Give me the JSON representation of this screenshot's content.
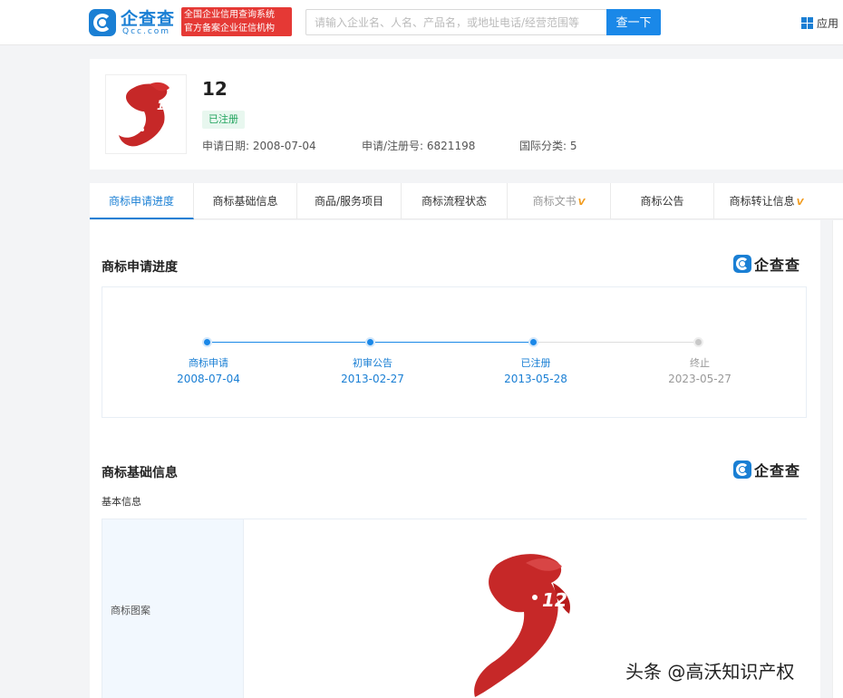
{
  "header": {
    "logo_cn": "企查查",
    "logo_en": "Qcc.com",
    "badge_line1": "全国企业信用查询系统",
    "badge_line2": "官方备案企业征信机构",
    "search_placeholder": "请输入企业名、人名、产品名，或地址电话/经营范围等",
    "search_button": "查一下",
    "apps_label": "应用",
    "brand_color": "#1a7fd4"
  },
  "trademark": {
    "name": "12",
    "status": "已注册",
    "apply_date": "申请日期: 2008-07-04",
    "reg_no": "申请/注册号: 6821198",
    "intl_class": "国际分类: 5"
  },
  "tabs": [
    {
      "label": "商标申请进度",
      "active": true
    },
    {
      "label": "商标基础信息"
    },
    {
      "label": "商品/服务项目"
    },
    {
      "label": "商标流程状态"
    },
    {
      "label": "商标文书",
      "vip": true
    },
    {
      "label": "商标公告"
    },
    {
      "label": "商标转让信息",
      "vip": true
    }
  ],
  "vip_mark": "V",
  "progress": {
    "title": "商标申请进度",
    "brand": "企查查",
    "steps": [
      {
        "label": "商标申请",
        "date": "2008-07-04",
        "done": true
      },
      {
        "label": "初审公告",
        "date": "2013-02-27",
        "done": true
      },
      {
        "label": "已注册",
        "date": "2013-05-28",
        "done": true
      },
      {
        "label": "终止",
        "date": "2023-05-27",
        "done": false
      }
    ]
  },
  "basic_info": {
    "title": "商标基础信息",
    "brand": "企查查",
    "sub_title": "基本信息",
    "row_label": "商标图案"
  },
  "watermark": "头条 @高沃知识产权"
}
